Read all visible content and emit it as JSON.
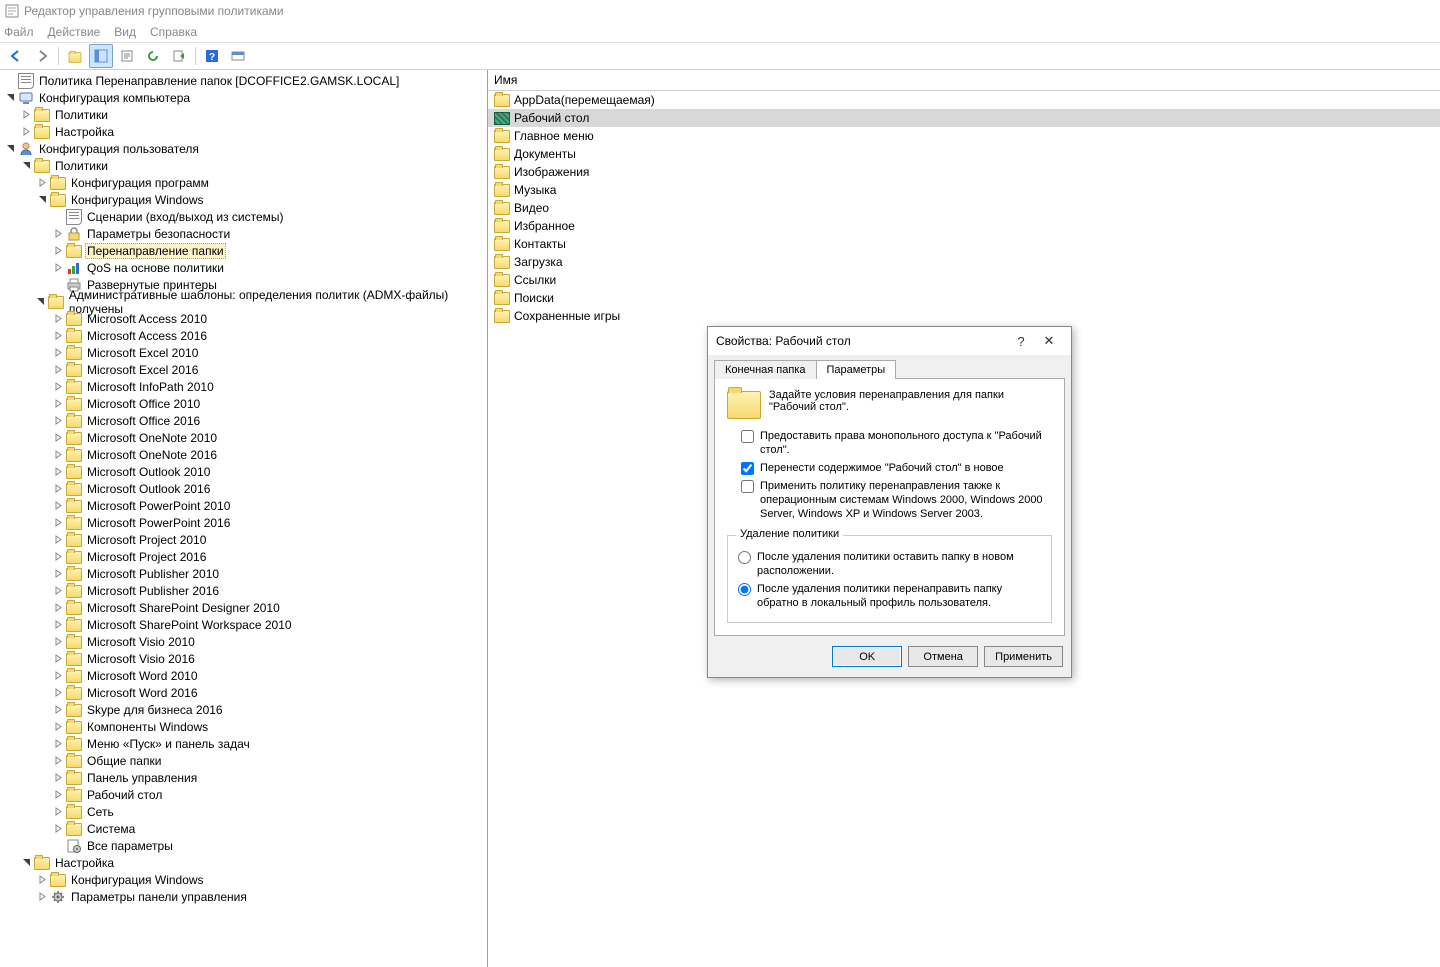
{
  "window_title": "Редактор управления групповыми политиками",
  "menu": {
    "file": "Файл",
    "action": "Действие",
    "view": "Вид",
    "help": "Справка"
  },
  "list_header": "Имя",
  "tree_root": "Политика Перенаправление папок [DCOFFICE2.GAMSK.LOCAL]",
  "comp_config": "Конфигурация компьютера",
  "user_config": "Конфигурация пользователя",
  "policies": "Политики",
  "preferences": "Настройка",
  "prog_config": "Конфигурация программ",
  "win_config": "Конфигурация Windows",
  "scripts": "Сценарии (вход/выход из системы)",
  "sec_params": "Параметры безопасности",
  "folder_redir": "Перенаправление папки",
  "qos": "QoS на основе политики",
  "deployed_printers": "Развернутые принтеры",
  "admin_templates": "Административные шаблоны: определения политик (ADMX-файлы) получены",
  "control_panel": "Панель управления",
  "desktop": "Рабочий стол",
  "network": "Сеть",
  "system": "Система",
  "all_settings": "Все параметры",
  "start_menu_taskbar": "Меню «Пуск» и панель задач",
  "shared_folders": "Общие папки",
  "win_components": "Компоненты Windows",
  "cp_params": "Параметры панели управления",
  "admx": [
    "Microsoft Access 2010",
    "Microsoft Access 2016",
    "Microsoft Excel 2010",
    "Microsoft Excel 2016",
    "Microsoft InfoPath 2010",
    "Microsoft Office 2010",
    "Microsoft Office 2016",
    "Microsoft OneNote 2010",
    "Microsoft OneNote 2016",
    "Microsoft Outlook 2010",
    "Microsoft Outlook 2016",
    "Microsoft PowerPoint 2010",
    "Microsoft PowerPoint 2016",
    "Microsoft Project 2010",
    "Microsoft Project 2016",
    "Microsoft Publisher 2010",
    "Microsoft Publisher 2016",
    "Microsoft SharePoint Designer 2010",
    "Microsoft SharePoint Workspace 2010",
    "Microsoft Visio 2010",
    "Microsoft Visio 2016",
    "Microsoft Word 2010",
    "Microsoft Word 2016",
    "Skype для бизнеса 2016"
  ],
  "list_items": [
    "AppData(перемещаемая)",
    "Рабочий стол",
    "Главное меню",
    "Документы",
    "Изображения",
    "Музыка",
    "Видео",
    "Избранное",
    "Контакты",
    "Загрузка",
    "Ссылки",
    "Поиски",
    "Сохраненные игры"
  ],
  "list_selected_index": 1,
  "dialog": {
    "title": "Свойства: Рабочий стол",
    "tab_target": "Конечная папка",
    "tab_params": "Параметры",
    "hint": "Задайте условия перенаправления для папки \"Рабочий стол\".",
    "chk1": "Предоставить права монопольного доступа к \"Рабочий стол\".",
    "chk2": "Перенести содержимое \"Рабочий стол\" в новое",
    "chk3": "Применить политику перенаправления также к операционным системам Windows 2000, Windows 2000 Server, Windows XP и Windows Server 2003.",
    "grp_title": "Удаление политики",
    "rad1": "После удаления политики оставить папку в новом расположении.",
    "rad2": "После удаления политики перенаправить папку обратно в локальный профиль пользователя.",
    "ok": "OK",
    "cancel": "Отмена",
    "apply": "Применить",
    "help": "?",
    "close": "✕"
  }
}
